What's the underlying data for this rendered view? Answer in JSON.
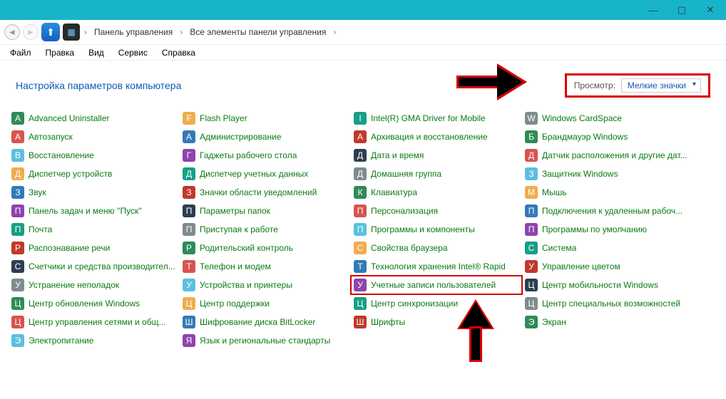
{
  "titlebar": {
    "min": "—",
    "max": "▢",
    "close": "✕"
  },
  "breadcrumb": {
    "root_glyph": "▸",
    "items": [
      "Панель управления",
      "Все элементы панели управления"
    ]
  },
  "menu": [
    "Файл",
    "Правка",
    "Вид",
    "Сервис",
    "Справка"
  ],
  "header": {
    "title": "Настройка параметров компьютера",
    "view_label": "Просмотр:",
    "view_value": "Мелкие значки"
  },
  "columns": [
    [
      "Advanced Uninstaller",
      "Автозапуск",
      "Восстановление",
      "Диспетчер устройств",
      "Звук",
      "Панель задач и меню ''Пуск''",
      "Почта",
      "Распознавание речи",
      "Счетчики и средства производител...",
      "Устранение неполадок",
      "Центр обновления Windows",
      "Центр управления сетями и общ...",
      "Электропитание"
    ],
    [
      "Flash Player",
      "Администрирование",
      "Гаджеты рабочего стола",
      "Диспетчер учетных данных",
      "Значки области уведомлений",
      "Параметры папок",
      "Приступая к работе",
      "Родительский контроль",
      "Телефон и модем",
      "Устройства и принтеры",
      "Центр поддержки",
      "Шифрование диска BitLocker",
      "Язык и региональные стандарты"
    ],
    [
      "Intel(R) GMA Driver for Mobile",
      "Архивация и восстановление",
      "Дата и время",
      "Домашняя группа",
      "Клавиатура",
      "Персонализация",
      "Программы и компоненты",
      "Свойства браузера",
      "Технология хранения Intel® Rapid",
      "Учетные записи пользователей",
      "Центр синхронизации",
      "Шрифты"
    ],
    [
      "Windows CardSpace",
      "Брандмауэр Windows",
      "Датчик расположения и другие дат...",
      "Защитник Windows",
      "Мышь",
      "Подключения к удаленным рабоч...",
      "Программы по умолчанию",
      "Система",
      "Управление цветом",
      "Центр мобильности Windows",
      "Центр специальных возможностей",
      "Экран"
    ]
  ],
  "highlight": {
    "col": 2,
    "row": 9
  },
  "grid_rows": 13
}
